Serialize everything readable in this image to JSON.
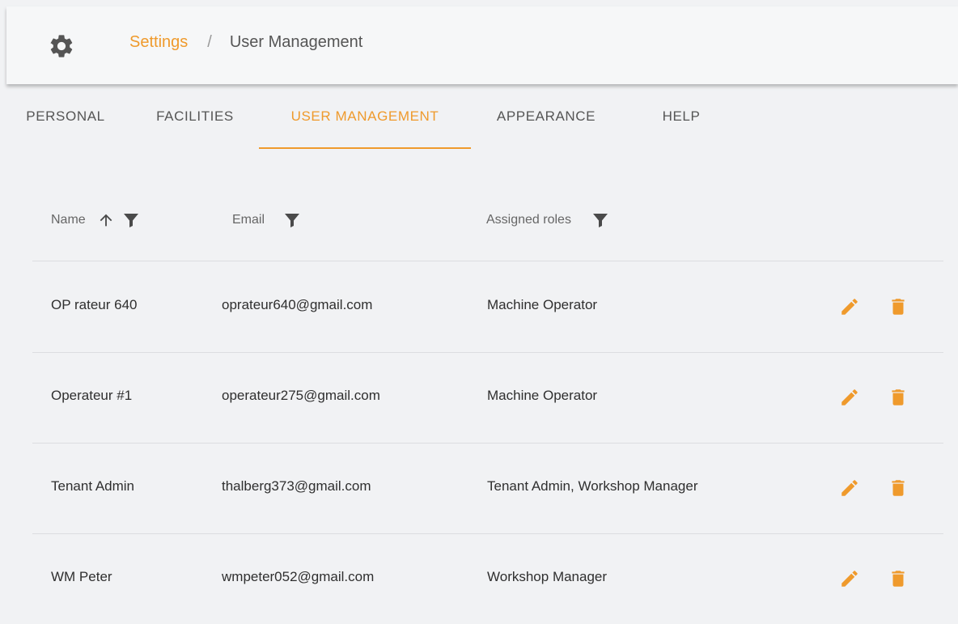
{
  "breadcrumb": {
    "parent": "Settings",
    "separator": "/",
    "current": "User Management"
  },
  "tabs": [
    {
      "label": "PERSONAL"
    },
    {
      "label": "FACILITIES"
    },
    {
      "label": "USER MANAGEMENT",
      "active": true
    },
    {
      "label": "APPEARANCE"
    },
    {
      "label": "HELP"
    }
  ],
  "table": {
    "columns": {
      "name": "Name",
      "email": "Email",
      "roles": "Assigned roles"
    },
    "sort": {
      "column": "Name",
      "direction": "ascending"
    },
    "rows": [
      {
        "name": "OP rateur 640",
        "email": "oprateur640@gmail.com",
        "roles": "Machine Operator"
      },
      {
        "name": "Operateur #1",
        "email": "operateur275@gmail.com",
        "roles": "Machine Operator"
      },
      {
        "name": "Tenant Admin",
        "email": "thalberg373@gmail.com",
        "roles": "Tenant Admin, Workshop Manager"
      },
      {
        "name": "WM Peter",
        "email": "wmpeter052@gmail.com",
        "roles": "Workshop Manager"
      }
    ]
  },
  "icons": {
    "settings": "gear-icon",
    "sort": "arrow-up-icon",
    "filter": "filter-icon",
    "edit": "pencil-icon",
    "delete": "trash-icon"
  },
  "colors": {
    "accent": "#ef9a2c",
    "background": "#f1f2f4",
    "topbar": "#f6f7f8",
    "icon": "#4a4a4a"
  }
}
